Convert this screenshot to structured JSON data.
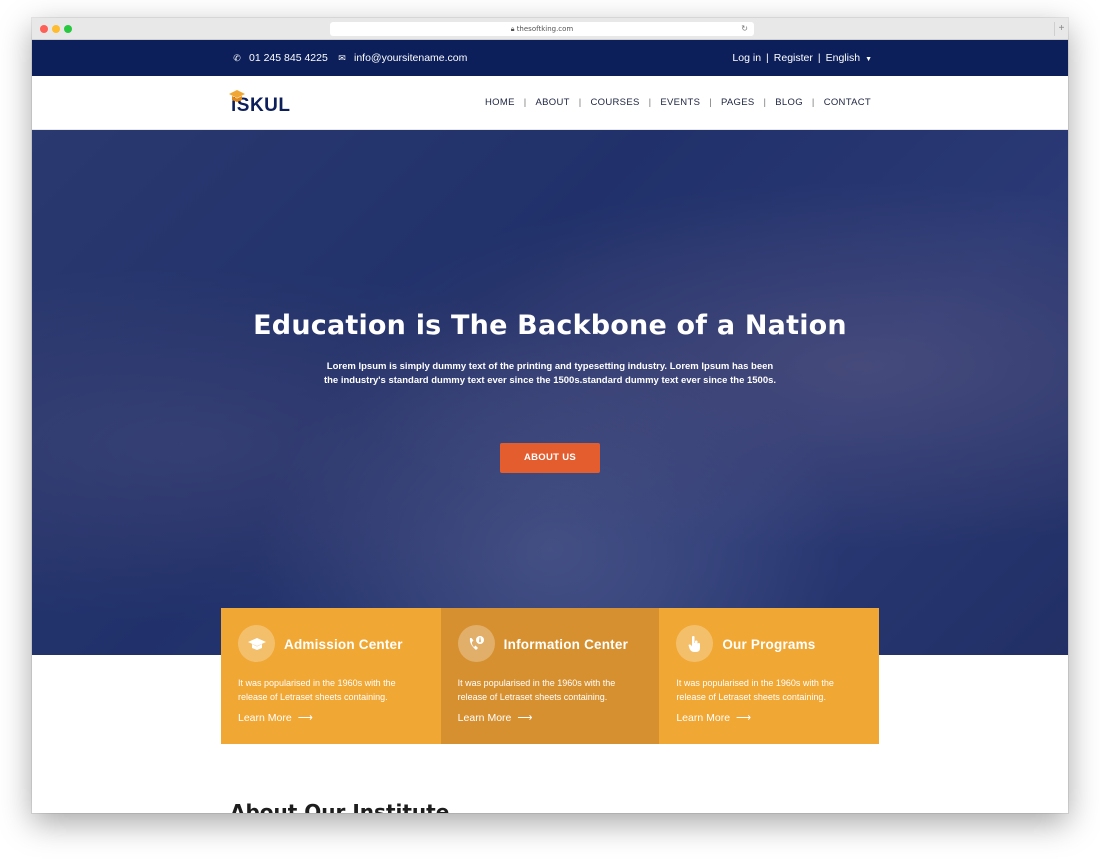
{
  "browser": {
    "url": "thesoftking.com"
  },
  "topbar": {
    "phone": "01 245 845 4225",
    "email": "info@yoursitename.com",
    "login": "Log in",
    "register": "Register",
    "language": "English",
    "separator": "|"
  },
  "header": {
    "logo_text": "iSKUL",
    "nav": [
      "HOME",
      "ABOUT",
      "COURSES",
      "EVENTS",
      "PAGES",
      "BLOG",
      "CONTACT"
    ],
    "nav_separator": "|"
  },
  "hero": {
    "title": "Education is The Backbone of a Nation",
    "subtitle": "Lorem Ipsum is simply dummy text of the printing and typesetting industry. Lorem Ipsum has been the industry's standard dummy text ever since the 1500s.standard dummy text ever since the 1500s.",
    "button": "ABOUT US"
  },
  "cards": [
    {
      "title": "Admission Center",
      "text": "It was popularised in the 1960s with the release of Letraset sheets containing.",
      "link": "Learn More",
      "icon": "graduation-cap-icon"
    },
    {
      "title": "Information Center",
      "text": "It was popularised in the 1960s with the release of Letraset sheets containing.",
      "link": "Learn More",
      "icon": "phone-info-icon"
    },
    {
      "title": "Our Programs",
      "text": "It was popularised in the 1960s with the release of Letraset sheets containing.",
      "link": "Learn More",
      "icon": "hand-pointer-icon"
    }
  ],
  "about": {
    "title": "About Our Institute"
  },
  "colors": {
    "topbar": "#0c1f5b",
    "accent_button": "#e35d2f",
    "card": "#f0a733",
    "card_mid": "#d69030"
  }
}
